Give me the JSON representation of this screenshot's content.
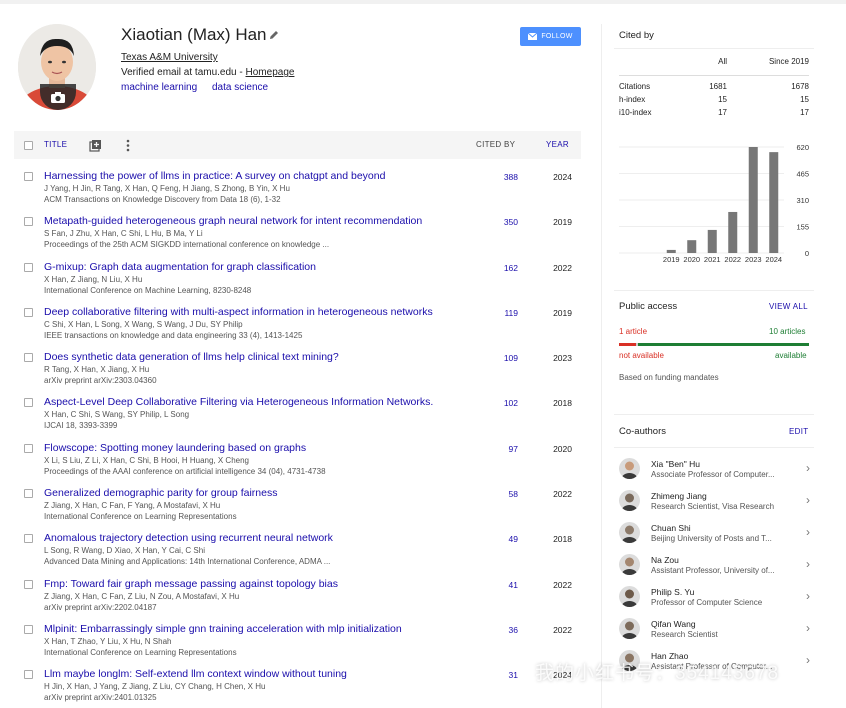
{
  "profile": {
    "name": "Xiaotian (Max) Han",
    "affiliation": "Texas A&M University",
    "email_prefix": "Verified email at tamu.edu - ",
    "homepage": "Homepage",
    "interests": [
      "machine learning",
      "data science"
    ],
    "follow_label": "FOLLOW"
  },
  "table": {
    "headers": {
      "title": "TITLE",
      "cited_by": "CITED BY",
      "year": "YEAR"
    },
    "rows": [
      {
        "title": "Harnessing the power of llms in practice: A survey on chatgpt and beyond",
        "authors": "J Yang, H Jin, R Tang, X Han, Q Feng, H Jiang, S Zhong, B Yin, X Hu",
        "venue": "ACM Transactions on Knowledge Discovery from Data 18 (6), 1-32",
        "cited": "388",
        "year": "2024"
      },
      {
        "title": "Metapath-guided heterogeneous graph neural network for intent recommendation",
        "authors": "S Fan, J Zhu, X Han, C Shi, L Hu, B Ma, Y Li",
        "venue": "Proceedings of the 25th ACM SIGKDD international conference on knowledge ...",
        "cited": "350",
        "year": "2019"
      },
      {
        "title": "G-mixup: Graph data augmentation for graph classification",
        "authors": "X Han, Z Jiang, N Liu, X Hu",
        "venue": "International Conference on Machine Learning, 8230-8248",
        "cited": "162",
        "year": "2022"
      },
      {
        "title": "Deep collaborative filtering with multi-aspect information in heterogeneous networks",
        "authors": "C Shi, X Han, L Song, X Wang, S Wang, J Du, SY Philip",
        "venue": "IEEE transactions on knowledge and data engineering 33 (4), 1413-1425",
        "cited": "119",
        "year": "2019"
      },
      {
        "title": "Does synthetic data generation of llms help clinical text mining?",
        "authors": "R Tang, X Han, X Jiang, X Hu",
        "venue": "arXiv preprint arXiv:2303.04360",
        "cited": "109",
        "year": "2023"
      },
      {
        "title": "Aspect-Level Deep Collaborative Filtering via Heterogeneous Information Networks.",
        "authors": "X Han, C Shi, S Wang, SY Philip, L Song",
        "venue": "IJCAI 18, 3393-3399",
        "cited": "102",
        "year": "2018"
      },
      {
        "title": "Flowscope: Spotting money laundering based on graphs",
        "authors": "X Li, S Liu, Z Li, X Han, C Shi, B Hooi, H Huang, X Cheng",
        "venue": "Proceedings of the AAAI conference on artificial intelligence 34 (04), 4731-4738",
        "cited": "97",
        "year": "2020"
      },
      {
        "title": "Generalized demographic parity for group fairness",
        "authors": "Z Jiang, X Han, C Fan, F Yang, A Mostafavi, X Hu",
        "venue": "International Conference on Learning Representations",
        "cited": "58",
        "year": "2022"
      },
      {
        "title": "Anomalous trajectory detection using recurrent neural network",
        "authors": "L Song, R Wang, D Xiao, X Han, Y Cai, C Shi",
        "venue": "Advanced Data Mining and Applications: 14th International Conference, ADMA ...",
        "cited": "49",
        "year": "2018"
      },
      {
        "title": "Fmp: Toward fair graph message passing against topology bias",
        "authors": "Z Jiang, X Han, C Fan, Z Liu, N Zou, A Mostafavi, X Hu",
        "venue": "arXiv preprint arXiv:2202.04187",
        "cited": "41",
        "year": "2022"
      },
      {
        "title": "Mlpinit: Embarrassingly simple gnn training acceleration with mlp initialization",
        "authors": "X Han, T Zhao, Y Liu, X Hu, N Shah",
        "venue": "International Conference on Learning Representations",
        "cited": "36",
        "year": "2022"
      },
      {
        "title": "Llm maybe longlm: Self-extend llm context window without tuning",
        "authors": "H Jin, X Han, J Yang, Z Jiang, Z Liu, CY Chang, H Chen, X Hu",
        "venue": "arXiv preprint arXiv:2401.01325",
        "cited": "31",
        "year": "2024"
      }
    ]
  },
  "cited_by": {
    "title": "Cited by",
    "col_all": "All",
    "col_since": "Since 2019",
    "rows": [
      {
        "label": "Citations",
        "all": "1681",
        "since": "1678"
      },
      {
        "label": "h-index",
        "all": "15",
        "since": "15"
      },
      {
        "label": "i10-index",
        "all": "17",
        "since": "17"
      }
    ]
  },
  "chart_data": {
    "type": "bar",
    "categories": [
      "2019",
      "2020",
      "2021",
      "2022",
      "2023",
      "2024"
    ],
    "values": [
      18,
      75,
      135,
      240,
      620,
      590
    ],
    "ylim": [
      0,
      620
    ],
    "yticks": [
      "620",
      "465",
      "310",
      "155",
      "0"
    ],
    "bar_color": "#777777"
  },
  "public_access": {
    "title": "Public access",
    "view_all": "VIEW ALL",
    "left_count": "1 article",
    "right_count": "10 articles",
    "left_status": "not available",
    "right_status": "available",
    "note": "Based on funding mandates",
    "not_available_fraction": 0.09
  },
  "coauthors": {
    "title": "Co-authors",
    "edit": "EDIT",
    "items": [
      {
        "name": "Xia \"Ben\" Hu",
        "affiliation": "Associate Professor of Computer..."
      },
      {
        "name": "Zhimeng Jiang",
        "affiliation": "Research Scientist, Visa Research"
      },
      {
        "name": "Chuan Shi",
        "affiliation": "Beijing University of Posts and T..."
      },
      {
        "name": "Na Zou",
        "affiliation": "Assistant Professor, University of..."
      },
      {
        "name": "Philip S. Yu",
        "affiliation": "Professor of Computer Science"
      },
      {
        "name": "Qifan Wang",
        "affiliation": "Research Scientist"
      },
      {
        "name": "Han Zhao",
        "affiliation": "Assistant Professor of Computer..."
      }
    ]
  },
  "watermark": "我的小红书号：354143678"
}
